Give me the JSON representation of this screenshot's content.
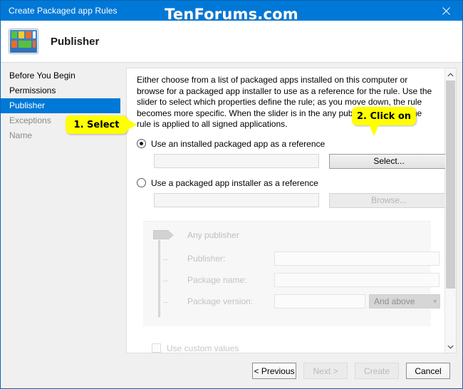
{
  "window": {
    "title": "Create Packaged app Rules",
    "close_icon": "close-icon",
    "watermark": "TenForums.com"
  },
  "header": {
    "title": "Publisher",
    "icon": "packaged-app-icon"
  },
  "sidebar": {
    "items": [
      {
        "label": "Before You Begin",
        "state": "visited"
      },
      {
        "label": "Permissions",
        "state": "visited"
      },
      {
        "label": "Publisher",
        "state": "selected"
      },
      {
        "label": "Exceptions",
        "state": "pending"
      },
      {
        "label": "Name",
        "state": "pending"
      }
    ]
  },
  "main": {
    "instructions": "Either choose from a list of packaged apps installed on this computer or browse for a packaged app installer to use as a reference for the rule. Use the slider to select which properties define the rule; as you move down, the rule becomes more specific. When the slider is in the any publisher position, the rule is applied to all signed applications.",
    "reference_options": [
      {
        "label": "Use an installed packaged app as a reference",
        "checked": true,
        "field_value": "",
        "button_label": "Select...",
        "button_enabled": true
      },
      {
        "label": "Use a packaged app installer as a reference",
        "checked": false,
        "field_value": "",
        "button_label": "Browse...",
        "button_enabled": false
      }
    ],
    "publisher_block": {
      "enabled": false,
      "slider_position": "Any publisher",
      "any_publisher_label": "Any publisher",
      "rows": [
        {
          "label": "Publisher:",
          "value": ""
        },
        {
          "label": "Package name:",
          "value": ""
        },
        {
          "label": "Package version:",
          "value": ""
        }
      ],
      "version_comparison": "And above",
      "custom_values_label": "Use custom values",
      "custom_values_checked": false
    },
    "scrollbar": {
      "up_arrow": "chevron-up-icon",
      "down_arrow": "chevron-down-icon"
    }
  },
  "footer": {
    "buttons": [
      {
        "label": "< Previous",
        "enabled": true
      },
      {
        "label": "Next >",
        "enabled": false
      },
      {
        "label": "Create",
        "enabled": false
      },
      {
        "label": "Cancel",
        "enabled": true
      }
    ]
  },
  "callouts": [
    {
      "text": "1. Select"
    },
    {
      "text": "2. Click on"
    }
  ],
  "colors": {
    "accent": "#0078d7",
    "callout": "#ffff00",
    "window_bg": "#f0f0f0"
  }
}
